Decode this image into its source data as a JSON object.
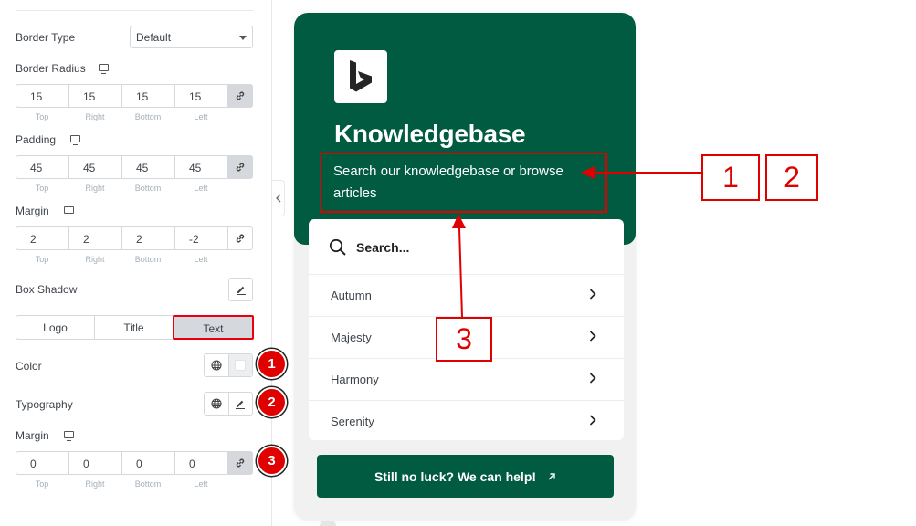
{
  "panel": {
    "border_type": {
      "label": "Border Type",
      "value": "Default"
    },
    "border_radius": {
      "label": "Border Radius",
      "values": [
        "15",
        "15",
        "15",
        "15"
      ]
    },
    "padding": {
      "label": "Padding",
      "values": [
        "45",
        "45",
        "45",
        "45"
      ]
    },
    "margin": {
      "label": "Margin",
      "values": [
        "2",
        "2",
        "2",
        "-2"
      ]
    },
    "side_labels": [
      "Top",
      "Right",
      "Bottom",
      "Left"
    ],
    "box_shadow_label": "Box Shadow",
    "tabs": [
      "Logo",
      "Title",
      "Text"
    ],
    "active_tab": "Text",
    "color_label": "Color",
    "typography_label": "Typography",
    "text_margin": {
      "label": "Margin",
      "values": [
        "0",
        "0",
        "0",
        "0"
      ]
    },
    "badges": [
      "1",
      "2",
      "3"
    ]
  },
  "card": {
    "title": "Knowledgebase",
    "text": "Search our knowledgebase or browse articles",
    "search_placeholder": "Search...",
    "items": [
      "Autumn",
      "Majesty",
      "Harmony",
      "Serenity"
    ],
    "button_label": "Still no luck? We can help!",
    "hero_color": "#015b40"
  },
  "annotations": {
    "labels": [
      "1",
      "2",
      "3"
    ],
    "color": "#e00000"
  }
}
